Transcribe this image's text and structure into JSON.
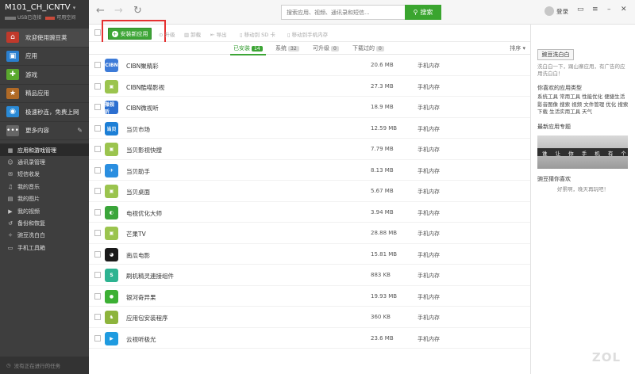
{
  "device": {
    "name": "M101_CH_ICNTV",
    "status": "USB已连接",
    "storage": "可用空间"
  },
  "sidebar": {
    "nav": [
      {
        "label": "欢迎使用豌豆荚",
        "icon": "home-icon",
        "color": "#c0392b"
      },
      {
        "label": "应用",
        "icon": "bag-icon",
        "color": "#2a7fcf"
      },
      {
        "label": "游戏",
        "icon": "gamepad-icon",
        "color": "#5aa92e"
      },
      {
        "label": "精品应用",
        "icon": "star-bag-icon",
        "color": "#b06a26"
      },
      {
        "label": "极速秒连，免费上网",
        "icon": "wifi-icon",
        "color": "#2a8ad6"
      },
      {
        "label": "更多内容",
        "icon": "dots-icon",
        "color": "#666666"
      }
    ],
    "manage": [
      {
        "label": "应用和游戏管理",
        "icon": "app-manage-icon"
      },
      {
        "label": "通讯录管理",
        "icon": "contacts-icon"
      },
      {
        "label": "短信收发",
        "icon": "sms-icon"
      },
      {
        "label": "我的音乐",
        "icon": "music-icon"
      },
      {
        "label": "我的图片",
        "icon": "picture-icon"
      },
      {
        "label": "我的视频",
        "icon": "video-icon"
      },
      {
        "label": "备份和恢复",
        "icon": "backup-icon"
      },
      {
        "label": "豌豆洗白白",
        "icon": "clean-icon"
      },
      {
        "label": "手机工具箱",
        "icon": "toolbox-icon"
      }
    ],
    "tasks": "没有正在进行的任务"
  },
  "topbar": {
    "search_placeholder": "搜索应用、视频、通讯录和短信...",
    "search_button": "搜索",
    "login": "登录"
  },
  "toolbar": {
    "install": "安装新应用",
    "upgrade": "升级",
    "uninstall": "卸载",
    "export": "导出",
    "move_sd": "移动到 SD 卡",
    "move_phone": "移动到手机内存"
  },
  "tabs": [
    {
      "label": "已安装",
      "count": "14"
    },
    {
      "label": "系统",
      "count": "32"
    },
    {
      "label": "可升级",
      "count": "0"
    },
    {
      "label": "下载过的",
      "count": "0"
    }
  ],
  "sort": "排序",
  "apps": [
    {
      "name": "CIBN聚精彩",
      "size": "20.6 MB",
      "location": "手机内存",
      "icon": "cibn-jujingcai-icon",
      "color": "#3d7bd8",
      "glyph": "CIBN"
    },
    {
      "name": "CIBN酷喵影视",
      "size": "27.3 MB",
      "location": "手机内存",
      "icon": "android-cube-icon",
      "color": "#9bc44e",
      "glyph": "▣"
    },
    {
      "name": "CIBN微视听",
      "size": "18.9 MB",
      "location": "手机内存",
      "icon": "cibn-weishiting-icon",
      "color": "#2c6fd0",
      "glyph": "微视听"
    },
    {
      "name": "当贝市场",
      "size": "12.59 MB",
      "location": "手机内存",
      "icon": "dangbei-market-icon",
      "color": "#1d7fd6",
      "glyph": "当贝"
    },
    {
      "name": "当贝影视快搜",
      "size": "7.79 MB",
      "location": "手机内存",
      "icon": "android-cube-icon",
      "color": "#9bc44e",
      "glyph": "▣"
    },
    {
      "name": "当贝助手",
      "size": "8.13 MB",
      "location": "手机内存",
      "icon": "dangbei-assistant-icon",
      "color": "#2a8ee0",
      "glyph": "✈"
    },
    {
      "name": "当贝桌面",
      "size": "5.67 MB",
      "location": "手机内存",
      "icon": "android-cube-icon",
      "color": "#9bc44e",
      "glyph": "▣"
    },
    {
      "name": "电视优化大师",
      "size": "3.94 MB",
      "location": "手机内存",
      "icon": "tv-optimizer-icon",
      "color": "#3aa53a",
      "glyph": "◐"
    },
    {
      "name": "芒果TV",
      "size": "28.88 MB",
      "location": "手机内存",
      "icon": "android-cube-icon",
      "color": "#9bc44e",
      "glyph": "▣"
    },
    {
      "name": "南瓜电影",
      "size": "15.81 MB",
      "location": "手机内存",
      "icon": "pumpkin-movie-icon",
      "color": "#1a1a1a",
      "glyph": "◕"
    },
    {
      "name": "刷机精灵連接组件",
      "size": "883 KB",
      "location": "手机内存",
      "icon": "shield-s-icon",
      "color": "#2db391",
      "glyph": "S"
    },
    {
      "name": "银河奇异果",
      "size": "19.93 MB",
      "location": "手机内存",
      "icon": "kiwi-icon",
      "color": "#3cb034",
      "glyph": "●"
    },
    {
      "name": "应用包安装程序",
      "size": "360 KB",
      "location": "手机内存",
      "icon": "android-robot-icon",
      "color": "#8db43c",
      "glyph": "♞"
    },
    {
      "name": "云视听极光",
      "size": "23.6 MB",
      "location": "手机内存",
      "icon": "play-triangle-icon",
      "color": "#1f9be0",
      "glyph": "▶"
    }
  ],
  "right": {
    "clean_button": "豌豆洗白白",
    "clean_desc": "洗白白一下，踢山寨应用，有广告的应用洗白白！",
    "fav_title": "你喜欢的应用类型",
    "fav_types": "系统工具 常用工具 性能优化 便捷生活 影音图像 搜索 视频 文件管理 优化 搜索 下载 生活实用工具 天气",
    "topic_title": "最新应用专题",
    "banner_text": "谁 让 你 手 机 有 个 性",
    "guess_title": "豌豆猜你喜欢",
    "guess_empty": "好累啊，晚天再玩吧！",
    "watermark": "ZOL"
  }
}
